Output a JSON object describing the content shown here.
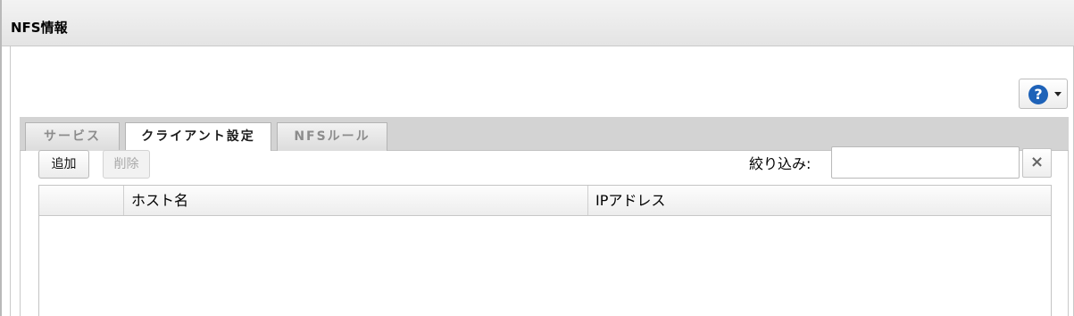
{
  "panel": {
    "title": "NFS情報"
  },
  "help": {
    "icon": "question-circle-icon",
    "label": "?"
  },
  "tabs": [
    {
      "label": "サービス",
      "active": false
    },
    {
      "label": "クライアント設定",
      "active": true
    },
    {
      "label": "NFSルール",
      "active": false
    }
  ],
  "toolbar": {
    "add_label": "追加",
    "delete_label": "削除",
    "filter_label": "絞り込み:",
    "filter_value": "",
    "clear_label": "×"
  },
  "grid": {
    "columns": [
      "",
      "ホスト名",
      "IPアドレス"
    ],
    "rows": []
  },
  "colors": {
    "accent": "#1e62b8",
    "tab_bar": "#d3d3d3",
    "header_bg": "#e9e9e9"
  }
}
